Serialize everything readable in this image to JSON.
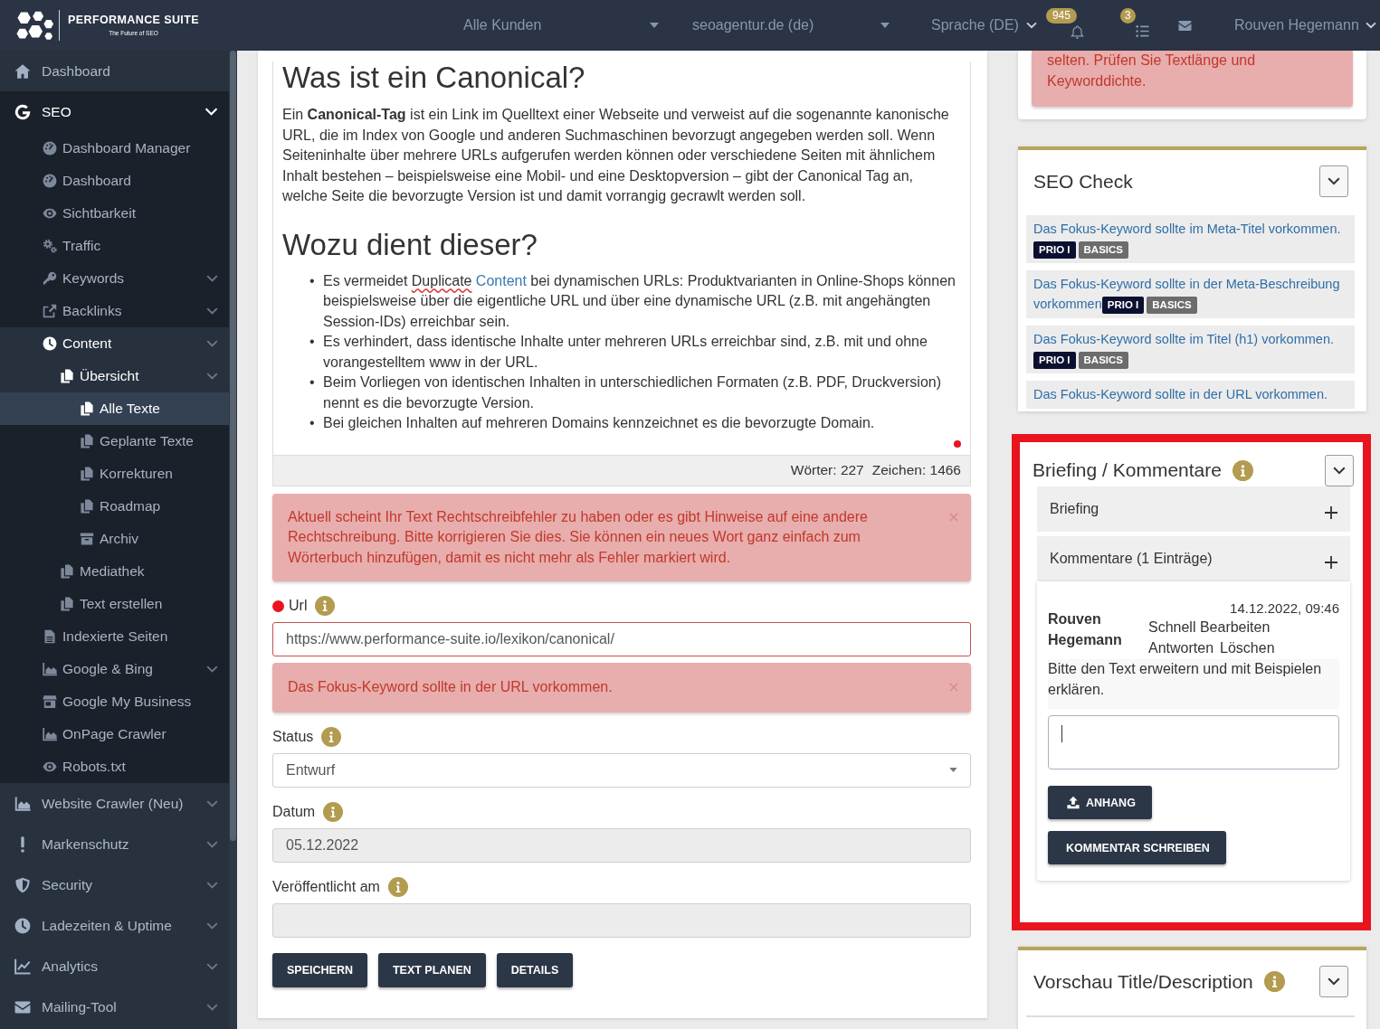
{
  "header": {
    "logo": {
      "title": "PERFORMANCE SUITE",
      "tagline": "The Future of SEO"
    },
    "dropdowns": [
      "Alle Kunden",
      "seoagentur.de (de)"
    ],
    "language": "Sprache (DE)",
    "notifications": "945",
    "tasks": "3",
    "user": "Rouven Hegemann"
  },
  "sidebar": {
    "items": [
      {
        "label": "Dashboard",
        "selected": false
      },
      {
        "label": "SEO",
        "selected": false,
        "expanded": true,
        "children": [
          {
            "label": "Dashboard Manager",
            "selected": false
          },
          {
            "label": "Dashboard",
            "selected": false
          },
          {
            "label": "Sichtbarkeit",
            "selected": false
          },
          {
            "label": "Traffic",
            "selected": false
          },
          {
            "label": "Keywords",
            "selected": false,
            "expanded": false
          },
          {
            "label": "Backlinks",
            "selected": false,
            "expanded": false
          },
          {
            "label": "Content",
            "selected": false,
            "expanded": true,
            "children": [
              {
                "label": "Übersicht",
                "selected": false,
                "expanded": true,
                "children": [
                  {
                    "label": "Alle Texte",
                    "selected": true
                  },
                  {
                    "label": "Geplante Texte",
                    "selected": false
                  },
                  {
                    "label": "Korrekturen",
                    "selected": false
                  },
                  {
                    "label": "Roadmap",
                    "selected": false
                  },
                  {
                    "label": "Archiv",
                    "selected": false
                  }
                ]
              },
              {
                "label": "Mediathek",
                "selected": false
              },
              {
                "label": "Text erstellen",
                "selected": false
              }
            ]
          },
          {
            "label": "Indexierte Seiten",
            "selected": false
          },
          {
            "label": "Google & Bing",
            "selected": false,
            "expanded": false
          },
          {
            "label": "Google My Business",
            "selected": false
          },
          {
            "label": "OnPage Crawler",
            "selected": false
          },
          {
            "label": "Robots.txt",
            "selected": false
          }
        ]
      },
      {
        "label": "Website Crawler (Neu)",
        "selected": false,
        "expanded": false
      },
      {
        "label": "Markenschutz",
        "selected": false,
        "expanded": false
      },
      {
        "label": "Security",
        "selected": false,
        "expanded": false
      },
      {
        "label": "Ladezeiten & Uptime",
        "selected": false,
        "expanded": false
      },
      {
        "label": "Analytics",
        "selected": false,
        "expanded": false
      },
      {
        "label": "Mailing-Tool",
        "selected": false,
        "expanded": false
      }
    ]
  },
  "main": {
    "editor": {
      "heading": "Was ist ein Canonical?",
      "paragraph": "Ein **Canonical-Tag** ist ein Link im Quelltext einer Webseite und verweist auf die sogenannte kanonische URL, die im Index von Google und anderen Suchmaschinen bevorzugt angegeben werden soll. Wenn Seiteninhalte über mehrere URLs aufgerufen werden können oder verschiedene Seiten mit ähnlichem Inhalt bestehen – beispielsweise eine Mobil- und eine Desktopversion – gibt der Canonical Tag an, welche Seite die bevorzugte Version ist und damit vorrangig gecrawlt werden soll.",
      "subheading": "Wozu dient dieser?",
      "bullets": [
        {
          "marker": "•",
          "segments": [
            {
              "text": "Es vermeidet "
            },
            {
              "text": "Duplicate",
              "kind": "misspelled"
            },
            {
              "text": "Content",
              "kind": "link"
            },
            {
              "text": " bei dynamischen URLs: Produktvarianten in Online-Shops können beispielsweise über die eigentliche URL und über eine dynamische URL (z.B. mit angehängten Session-IDs) erreichbar sein."
            }
          ]
        },
        {
          "marker": "•",
          "segments": [
            {
              "text": "Es verhindert, dass identische Inhalte unter mehreren URLs erreichbar sind, z.B. mit und ohne vorangestelltem www in der URL."
            }
          ]
        },
        {
          "marker": "•",
          "segments": [
            {
              "text": "Beim Vorliegen von identischen Inhalten in unterschiedlichen Formaten (z.B. PDF, Druckversion) nennt es die bevorzugte Version."
            }
          ]
        },
        {
          "marker": "•",
          "segments": [
            {
              "text": "Bei gleichen Inhalten auf mehreren Domains kennzeichnet es die bevorzugte Domain."
            }
          ]
        }
      ],
      "word_count": "Wörter: 227",
      "char_count": "Zeichen: 1466"
    },
    "spellcheck_alert": "Aktuell scheint Ihr Text Rechtschreibfehler zu haben oder es gibt Hinweise auf eine andere Rechtschreibung. Bitte korrigieren Sie dies. Sie können ein neues Wort ganz einfach zum Wörterbuch hinzufügen, damit es nicht mehr als Fehler markiert wird.",
    "fields": [
      {
        "kind": "text",
        "label": "Url",
        "value": "https://www.performance-suite.io/lexikon/canonical/",
        "error": true,
        "disabled": false,
        "alert": "Das Fokus-Keyword sollte in der URL vorkommen."
      },
      {
        "kind": "select",
        "label": "Status",
        "value": "Entwurf",
        "error": false,
        "disabled": false
      },
      {
        "kind": "text",
        "label": "Datum",
        "value": "05.12.2022",
        "error": false,
        "disabled": true
      },
      {
        "kind": "text",
        "label": "Veröffentlicht am",
        "error": false,
        "disabled": true
      }
    ],
    "buttons": [
      "SPEICHERN",
      "TEXT PLANEN",
      "DETAILS"
    ]
  },
  "right_panel": {
    "keyword_alert": "selten. Prüfen Sie Textlänge und Keyworddichte.",
    "seo_check": {
      "title": "SEO Check",
      "items": [
        {
          "text": "Das Fokus-Keyword sollte im Meta-Titel vorkommen.",
          "tags": [
            {
              "label": "PRIO I",
              "color": "#0c1030"
            },
            {
              "label": "BASICS",
              "color": "#6c6c6c"
            }
          ]
        },
        {
          "text": "Das Fokus-Keyword sollte in der Meta-Beschreibung vorkommen",
          "tags": [
            {
              "label": "PRIO I",
              "color": "#0c1030"
            },
            {
              "label": "BASICS",
              "color": "#6c6c6c"
            }
          ]
        },
        {
          "text": "Das Fokus-Keyword sollte im Titel (h1) vorkommen.",
          "tags": [
            {
              "label": "PRIO I",
              "color": "#0c1030"
            },
            {
              "label": "BASICS",
              "color": "#6c6c6c"
            }
          ]
        },
        {
          "text": "Das Fokus-Keyword sollte in der URL vorkommen."
        }
      ]
    },
    "briefing": {
      "title": "Briefing / Kommentare",
      "highlighted": true,
      "sections": [
        {
          "label": "Briefing",
          "expanded": false
        },
        {
          "label": "Kommentare (1 Einträge)",
          "expanded": true,
          "comments": [
            {
              "author": "Rouven Hegemann",
              "date": "14.12.2022, 09:46",
              "actions": [
                "Schnell Bearbeiten",
                "Antworten",
                "Löschen"
              ],
              "text": "Bitte den Text erweitern und mit Beispielen erklären."
            }
          ],
          "reply_field": {
            "focused": true
          },
          "buttons": [
            {
              "label": "ANHANG",
              "kind": "upload"
            },
            {
              "label": "KOMMENTAR SCHREIBEN",
              "kind": "submit"
            }
          ]
        }
      ]
    },
    "preview": {
      "title": "Vorschau Title/Description"
    }
  }
}
